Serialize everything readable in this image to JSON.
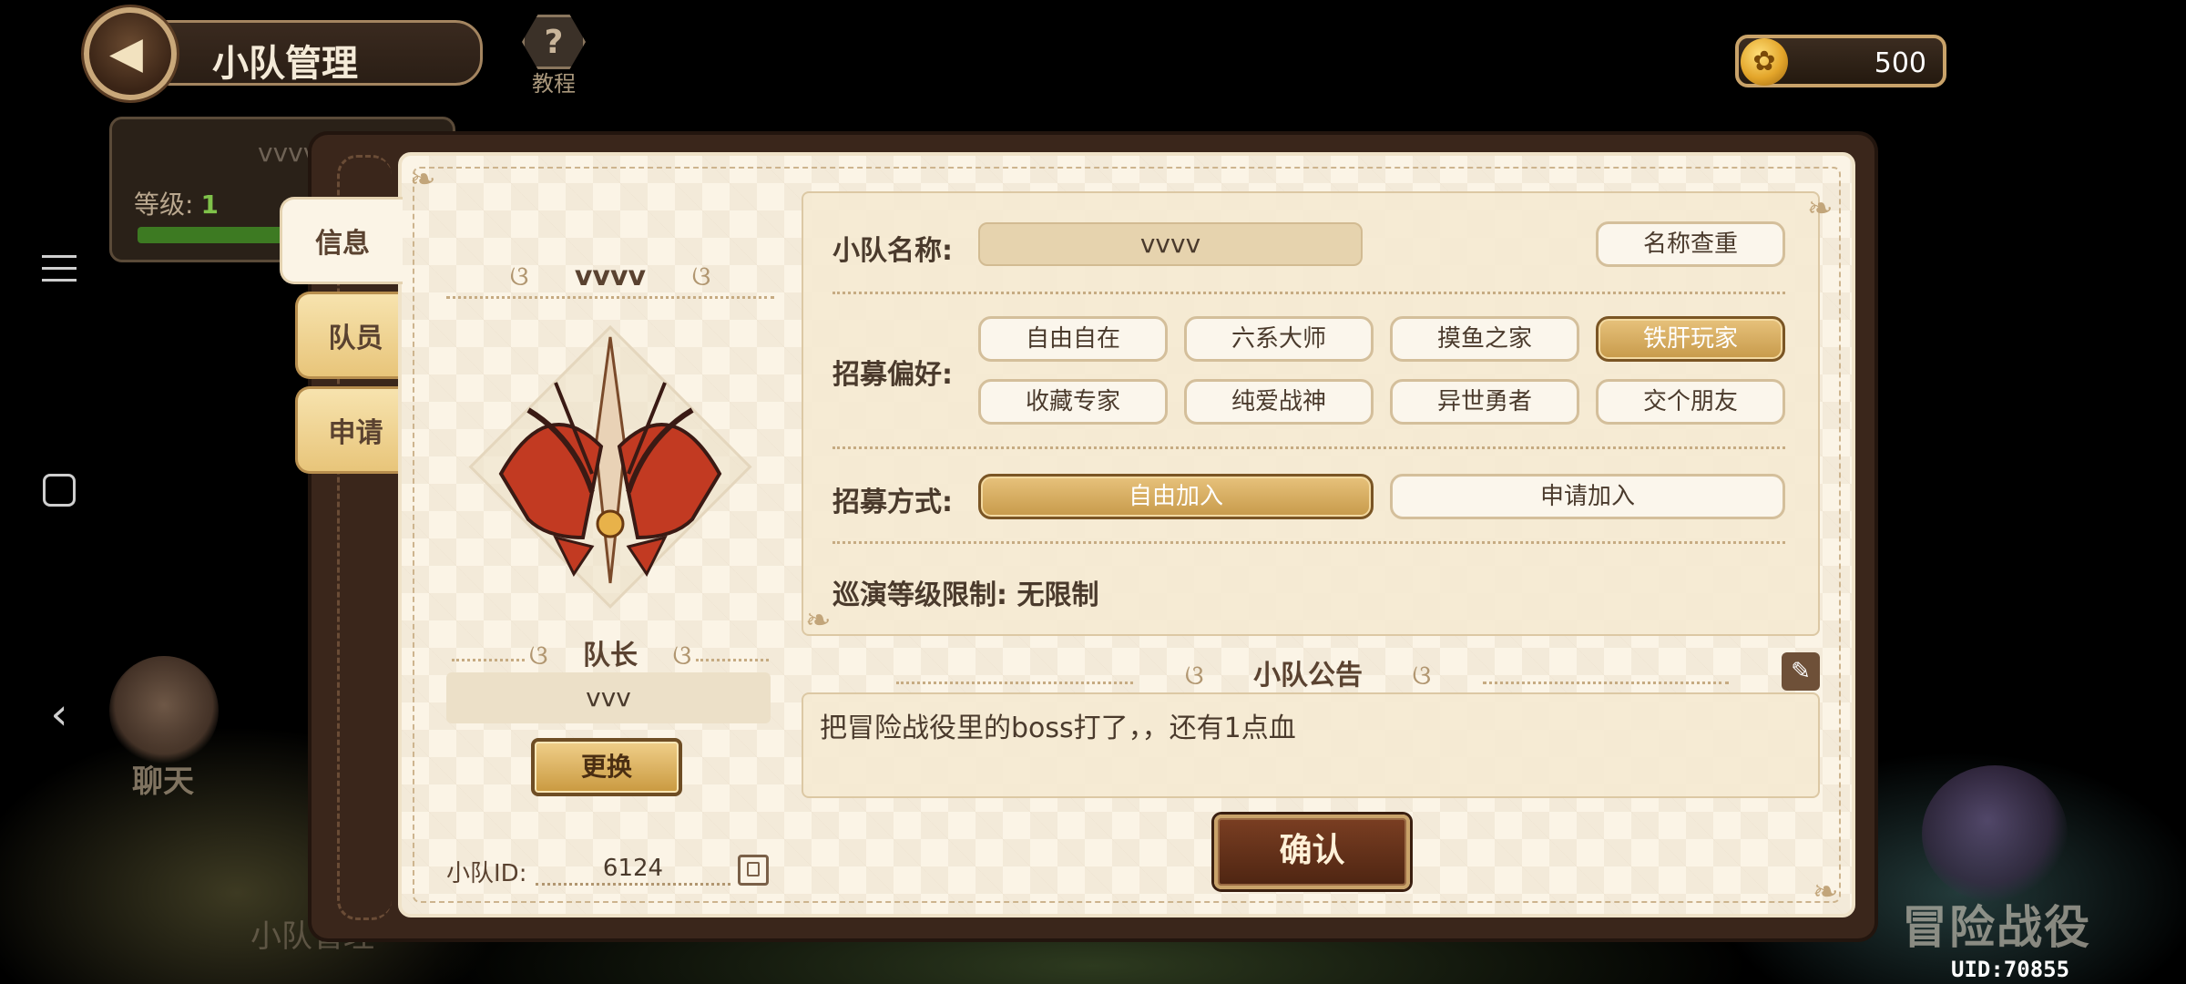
{
  "header": {
    "title": "小队管理",
    "tutorial_label": "教程",
    "coins": "500"
  },
  "background": {
    "bg_team_name": "vvvv",
    "bg_level_label": "等级:",
    "bg_level_value": "1",
    "bg_chat_label": "聊天",
    "bg_bottom_text": "小队管理",
    "bg_battle_label": "冒险战役",
    "uid": "UID:70855"
  },
  "tabs": [
    {
      "label": "信息"
    },
    {
      "label": "队员"
    },
    {
      "label": "申请"
    }
  ],
  "team": {
    "name": "vvvv",
    "leader_label": "队长",
    "leader_name": "vvv",
    "change_label": "更换",
    "id_label": "小队ID:",
    "id_value": "6124"
  },
  "settings": {
    "name_label": "小队名称:",
    "name_value": "vvvv",
    "rename_label": "名称查重",
    "recruit_pref_label": "招募偏好:",
    "preferences": [
      {
        "label": "自由自在",
        "selected": false
      },
      {
        "label": "六系大师",
        "selected": false
      },
      {
        "label": "摸鱼之家",
        "selected": false
      },
      {
        "label": "铁肝玩家",
        "selected": true
      },
      {
        "label": "收藏专家",
        "selected": false
      },
      {
        "label": "纯爱战神",
        "selected": false
      },
      {
        "label": "异世勇者",
        "selected": false
      },
      {
        "label": "交个朋友",
        "selected": false
      }
    ],
    "recruit_method_label": "招募方式:",
    "methods": [
      {
        "label": "自由加入",
        "selected": true
      },
      {
        "label": "申请加入",
        "selected": false
      }
    ],
    "level_limit": "巡演等级限制: 无限制"
  },
  "notice": {
    "title": "小队公告",
    "text": "把冒险战役里的boss打了，，还有1点血"
  },
  "confirm_label": "确认",
  "colors": {
    "selected_pill": "#c79a4a",
    "confirm_bg": "#5e2e17",
    "panel_bg": "#fbf4e6"
  }
}
